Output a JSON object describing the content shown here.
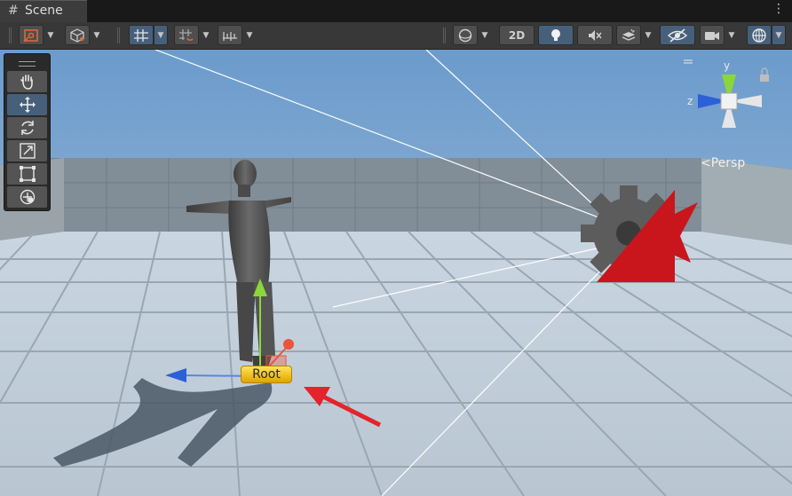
{
  "window": {
    "tab_label": "Scene",
    "tab_icon": "grid-hash-icon",
    "menu_icon": "kebab-menu-icon"
  },
  "toolbar": {
    "left_icons": [
      "transform-tool-icon",
      "cube-shaded-icon",
      "grid-snap-icon",
      "increment-snap-icon",
      "ruler-icon"
    ],
    "right_icons": [
      "draw-mode-sphere-icon",
      "lighting-bulb-icon",
      "audio-mute-icon",
      "effects-icon",
      "visibility-icon",
      "camera-icon",
      "gizmos-icon"
    ],
    "mode_2d_label": "2D"
  },
  "tools": {
    "items": [
      "hand",
      "move",
      "rotate",
      "scale",
      "rect",
      "transform"
    ],
    "active": "move"
  },
  "scene": {
    "root_label": "Root",
    "persp_label": "Persp"
  },
  "orientation_gizmo": {
    "y_label": "y",
    "z_label": "z",
    "y_color": "#8bd63a",
    "z_color": "#3a6ae0"
  },
  "colors": {
    "accent_active": "#46607c",
    "camera_red": "#c8161c",
    "annotation_arrow": "#e5232b"
  }
}
